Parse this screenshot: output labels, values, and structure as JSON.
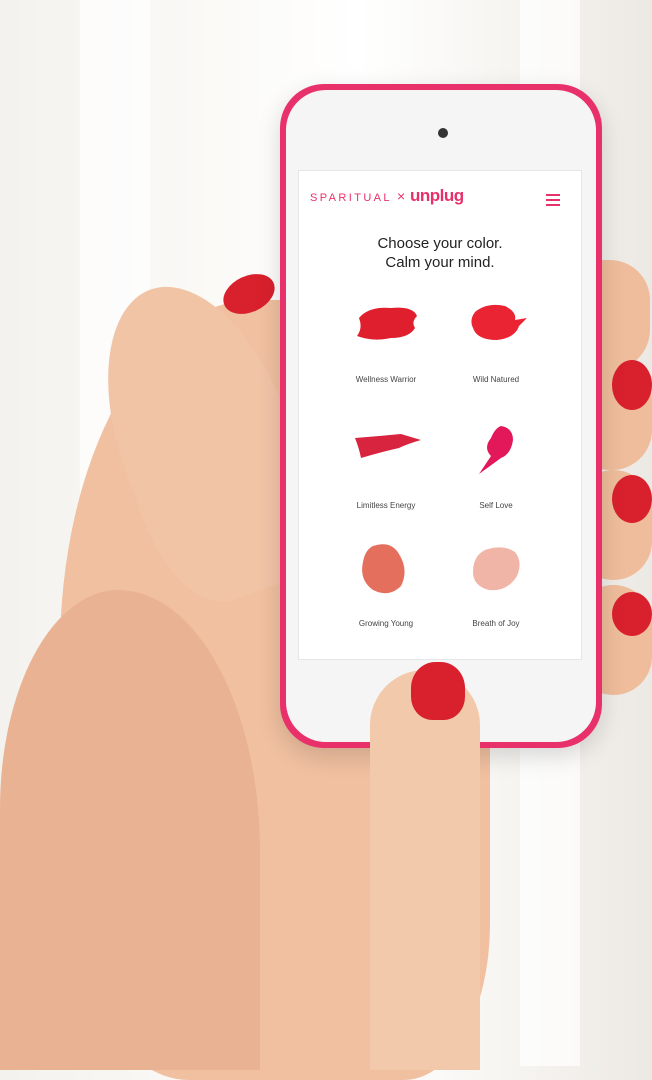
{
  "app": {
    "brand_left": "SPARITUAL",
    "brand_x": "×",
    "brand_right": "unplug",
    "menu_icon": "hamburger-menu-icon"
  },
  "screen": {
    "headline_line1": "Choose your color.",
    "headline_line2": "Calm your mind."
  },
  "colors": {
    "accent": "#e8316a",
    "phone_case": "#e8316a"
  },
  "swatches": [
    {
      "label": "Wellness Warrior",
      "color": "#e01f2e"
    },
    {
      "label": "Wild Natured",
      "color": "#ea2433"
    },
    {
      "label": "Limitless Energy",
      "color": "#d8243f"
    },
    {
      "label": "Self Love",
      "color": "#e3185a"
    },
    {
      "label": "Growing Young",
      "color": "#e46f5c"
    },
    {
      "label": "Breath of Joy",
      "color": "#f0b5a7"
    }
  ]
}
